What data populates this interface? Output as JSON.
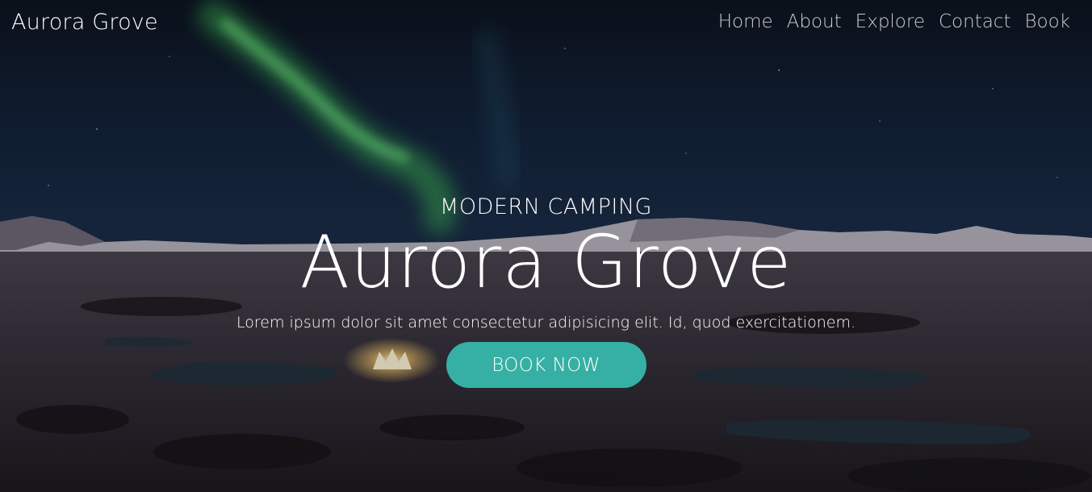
{
  "brand": {
    "name": "Aurora Grove"
  },
  "nav": {
    "links": [
      {
        "label": "Home"
      },
      {
        "label": "About"
      },
      {
        "label": "Explore"
      },
      {
        "label": "Contact"
      },
      {
        "label": "Book"
      }
    ]
  },
  "hero": {
    "eyebrow": "MODERN CAMPING",
    "title": "Aurora Grove",
    "tagline": "Lorem ipsum dolor sit amet consectetur adipisicing elit. Id, quod exercitationem.",
    "cta_label": "BOOK NOW"
  },
  "colors": {
    "accent": "#36b0a4",
    "text": "#ffffff",
    "sky": "#0f1b2e",
    "aurora": "#4fd66a"
  }
}
